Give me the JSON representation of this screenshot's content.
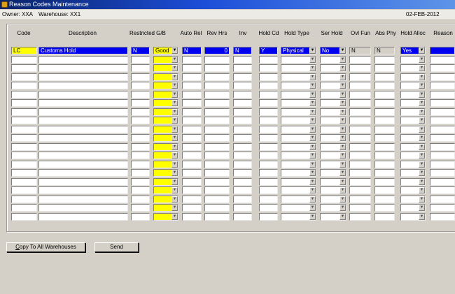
{
  "window": {
    "title": "Reason Codes Maintenance",
    "icon": "oracle-forms-icon"
  },
  "info": {
    "owner": "Owner: XXA",
    "warehouse": "Warehouse: XX1",
    "date": "02-FEB-2012"
  },
  "columns": [
    {
      "key": "code",
      "label": "Code"
    },
    {
      "key": "description",
      "label": "Description"
    },
    {
      "key": "restricted",
      "label": "Restricted"
    },
    {
      "key": "gb",
      "label": "G/B"
    },
    {
      "key": "auto_rel",
      "label": "Auto Rel"
    },
    {
      "key": "rev_hrs",
      "label": "Rev Hrs"
    },
    {
      "key": "inv",
      "label": "Inv"
    },
    {
      "key": "hold_cd",
      "label": "Hold Cd"
    },
    {
      "key": "hold_type",
      "label": "Hold Type"
    },
    {
      "key": "ser_hold",
      "label": "Ser Hold"
    },
    {
      "key": "ovl_fun",
      "label": "Ovl Fun"
    },
    {
      "key": "abs_phy",
      "label": "Abs Phy"
    },
    {
      "key": "hold_alloc",
      "label": "Hold Alloc"
    },
    {
      "key": "reason",
      "label": "Reason"
    }
  ],
  "rows": [
    {
      "code": "LC",
      "description": "Customs Hold",
      "restricted": "N",
      "gb": "Good",
      "auto_rel": "N",
      "rev_hrs": "0",
      "inv": "N",
      "hold_cd": "Y",
      "hold_type": "Physical",
      "ser_hold": "No",
      "ovl_fun": "N",
      "abs_phy": "N",
      "hold_alloc": "Yes",
      "reason": ""
    }
  ],
  "empty_row_count": 19,
  "buttons": {
    "copy_prefix": "C",
    "copy_rest": "opy To All Warehouses",
    "send": "Send"
  },
  "colors": {
    "selected_row": "#0000f0",
    "current_field": "#ffff00",
    "background": "#d4d0c8"
  }
}
